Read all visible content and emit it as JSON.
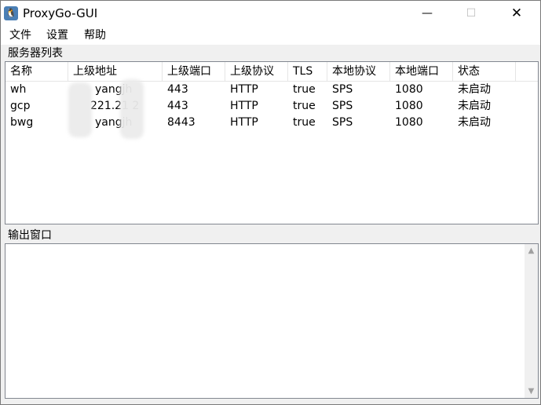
{
  "window": {
    "title": "ProxyGo-GUI",
    "icon": "penguin-icon",
    "minimize_glyph": "—",
    "maximize_glyph": "☐",
    "close_glyph": "✕"
  },
  "menu": {
    "file": "文件",
    "settings": "设置",
    "help": "帮助"
  },
  "server_list": {
    "label": "服务器列表",
    "columns": [
      "名称",
      "上级地址",
      "上级端口",
      "上级协议",
      "TLS",
      "本地协议",
      "本地端口",
      "状态"
    ],
    "rows": [
      [
        "wh",
        "yangjh",
        "443",
        "HTTP",
        "true",
        "SPS",
        "1080",
        "未启动"
      ],
      [
        "gcp",
        "221.21    2",
        "443",
        "HTTP",
        "true",
        "SPS",
        "1080",
        "未启动"
      ],
      [
        "bwg",
        "yangjh",
        "8443",
        "HTTP",
        "true",
        "SPS",
        "1080",
        "未启动"
      ]
    ]
  },
  "output": {
    "label": "输出窗口",
    "scroll_up": "▲",
    "scroll_down": "▼"
  }
}
